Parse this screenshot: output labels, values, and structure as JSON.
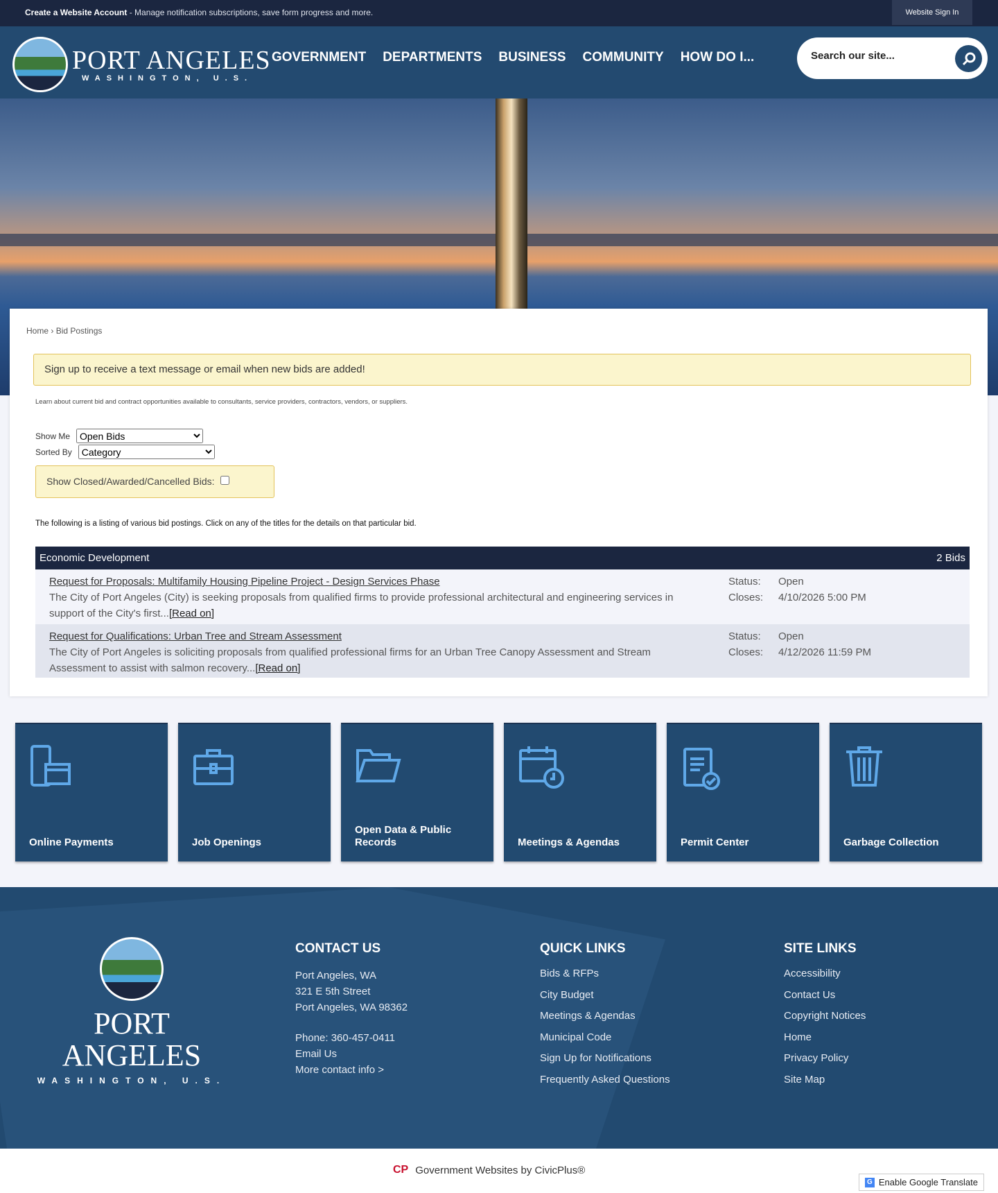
{
  "topbar": {
    "create_account": "Create a Website Account",
    "create_desc": " - Manage notification subscriptions, save form progress and more.",
    "sign_in": "Website Sign In"
  },
  "logo": {
    "title": "PORT ANGELES",
    "subtitle": "WASHINGTON, U.S."
  },
  "nav": [
    "GOVERNMENT",
    "DEPARTMENTS",
    "BUSINESS",
    "COMMUNITY",
    "HOW DO I..."
  ],
  "search": {
    "placeholder": "Search our site..."
  },
  "breadcrumb": {
    "home": "Home",
    "sep": " › ",
    "current": "Bid Postings"
  },
  "alert": {
    "link": "Sign up",
    "text": " to receive a text message or email when new bids are added!"
  },
  "description": "Learn about current bid and contract opportunities available to consultants, service providers, contractors, vendors, or suppliers.",
  "filters": {
    "show_me_label": "Show Me",
    "show_me_value": "Open Bids",
    "sorted_by_label": "Sorted By",
    "sorted_by_value": "Category",
    "closed_label": "Show Closed/Awarded/Cancelled Bids:"
  },
  "listing_intro": "The following is a listing of various bid postings. Click on any of the titles for the details on that particular bid.",
  "category": {
    "name": "Economic Development",
    "count": "2 Bids"
  },
  "bids": [
    {
      "title": "Request for Proposals: Multifamily Housing Pipeline Project - Design Services Phase",
      "body": "The City of Port Angeles (City) is seeking proposals from qualified firms to provide professional architectural and engineering services in support of the City's first...",
      "read_on": "[Read on]",
      "status_label": "Status:",
      "status": "Open",
      "closes_label": "Closes:",
      "closes": "4/10/2026 5:00 PM"
    },
    {
      "title": "Request for Qualifications: Urban Tree and Stream Assessment",
      "body": "The City of Port Angeles is soliciting proposals from qualified professional firms for an Urban Tree Canopy Assessment and Stream Assessment to assist with salmon recovery...",
      "read_on": "[Read on]",
      "status_label": "Status:",
      "status": "Open",
      "closes_label": "Closes:",
      "closes": "4/12/2026 11:59 PM"
    }
  ],
  "tiles": [
    {
      "label": "Online Payments",
      "icon": "payment-icon"
    },
    {
      "label": "Job Openings",
      "icon": "briefcase-icon"
    },
    {
      "label": "Open Data & Public Records",
      "icon": "folder-icon"
    },
    {
      "label": "Meetings & Agendas",
      "icon": "calendar-icon"
    },
    {
      "label": "Permit Center",
      "icon": "clipboard-check-icon"
    },
    {
      "label": "Garbage Collection",
      "icon": "trash-icon"
    }
  ],
  "footer": {
    "contact": {
      "heading": "CONTACT US",
      "lines": [
        "Port Angeles, WA",
        "321 E 5th Street",
        "Port Angeles, WA 98362"
      ],
      "phone": "Phone: 360-457-0411",
      "email": "Email Us",
      "more": "More contact info >"
    },
    "quick_links": {
      "heading": "QUICK LINKS",
      "items": [
        "Bids & RFPs",
        "City Budget",
        "Meetings & Agendas",
        "Municipal Code",
        "Sign Up for Notifications",
        "Frequently Asked Questions"
      ]
    },
    "site_links": {
      "heading": "SITE LINKS",
      "items": [
        "Accessibility",
        "Contact Us",
        "Copyright Notices",
        "Home",
        "Privacy Policy",
        "Site Map"
      ]
    }
  },
  "bottom": {
    "civicplus": "Government Websites by CivicPlus®",
    "translate": "Enable Google Translate"
  }
}
